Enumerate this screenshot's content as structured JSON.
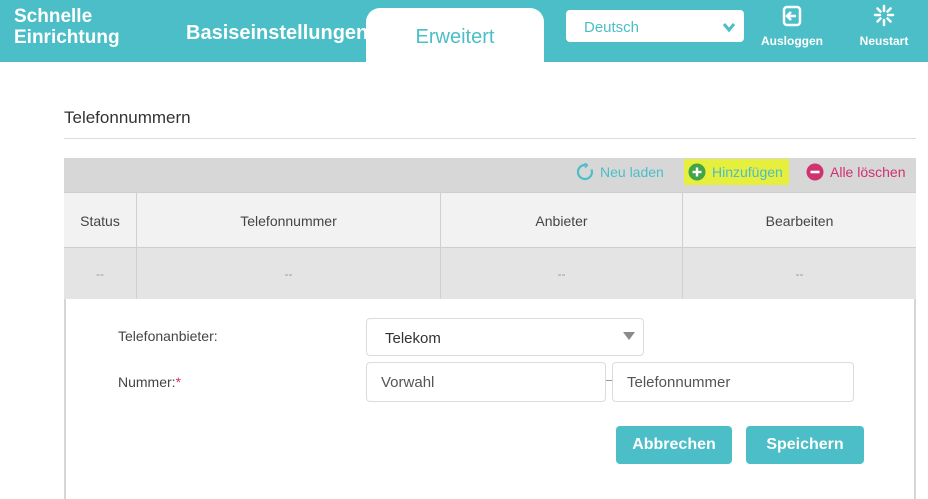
{
  "nav": {
    "quick_setup_line1": "Schnelle",
    "quick_setup_line2": "Einrichtung",
    "basic": "Basiseinstellungen",
    "advanced": "Erweitert",
    "language": "Deutsch",
    "logout": "Ausloggen",
    "reboot": "Neustart"
  },
  "section": {
    "title": "Telefonnummern"
  },
  "toolbar": {
    "reload": "Neu laden",
    "add": "Hinzufügen",
    "delete_all": "Alle löschen"
  },
  "table": {
    "headers": [
      "Status",
      "Telefonnummer",
      "Anbieter",
      "Bearbeiten"
    ],
    "rows": [
      [
        "--",
        "--",
        "--",
        "--"
      ]
    ]
  },
  "form": {
    "provider_label": "Telefonanbieter:",
    "provider_value": "Telekom",
    "number_label": "Nummer:",
    "required_mark": "*",
    "area_code_placeholder": "Vorwahl",
    "phone_placeholder": "Telefonnummer",
    "cancel": "Abbrechen",
    "save": "Speichern"
  },
  "colors": {
    "accent": "#4bbec7",
    "highlight": "#e6ef3e",
    "danger": "#d0316f"
  },
  "icons": {
    "logout": "logout-icon",
    "reboot": "reboot-icon",
    "reload": "reload-icon",
    "add": "plus-circle-icon",
    "delete": "minus-circle-icon",
    "dropdown": "chevron-down-icon"
  }
}
